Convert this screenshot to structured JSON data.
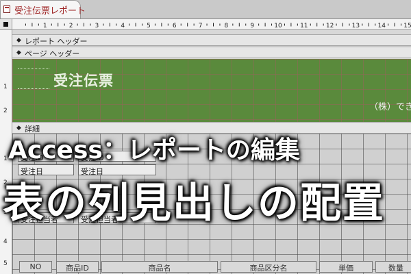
{
  "tab": {
    "label": "受注伝票レポート"
  },
  "ruler": {
    "h_numbers": [
      "1",
      "2",
      "3",
      "4",
      "5",
      "6",
      "7",
      "8",
      "9",
      "10",
      "11",
      "12",
      "13",
      "14",
      "15"
    ],
    "v_numbers": [
      "1",
      "2",
      "1",
      "2",
      "3",
      "4",
      "5"
    ]
  },
  "sections": {
    "report_header": "レポート ヘッダー",
    "page_header": "ページ ヘッダー",
    "detail": "詳細"
  },
  "header_band": {
    "title": "受注伝票",
    "company": "（株）でき",
    "color": "#5a8a3c"
  },
  "detail_controls": [
    {
      "label": "受注ID",
      "field": "受注ID"
    },
    {
      "label": "受注日",
      "field": "受注日"
    },
    {
      "label": "受注担当者",
      "field": "受注担当者"
    }
  ],
  "columns": [
    "NO",
    "商品ID",
    "商品名",
    "商品区分名",
    "単価",
    "数量"
  ],
  "caption": {
    "line1": "Access：レポートの編集",
    "line2": "表の列見出しの配置"
  }
}
